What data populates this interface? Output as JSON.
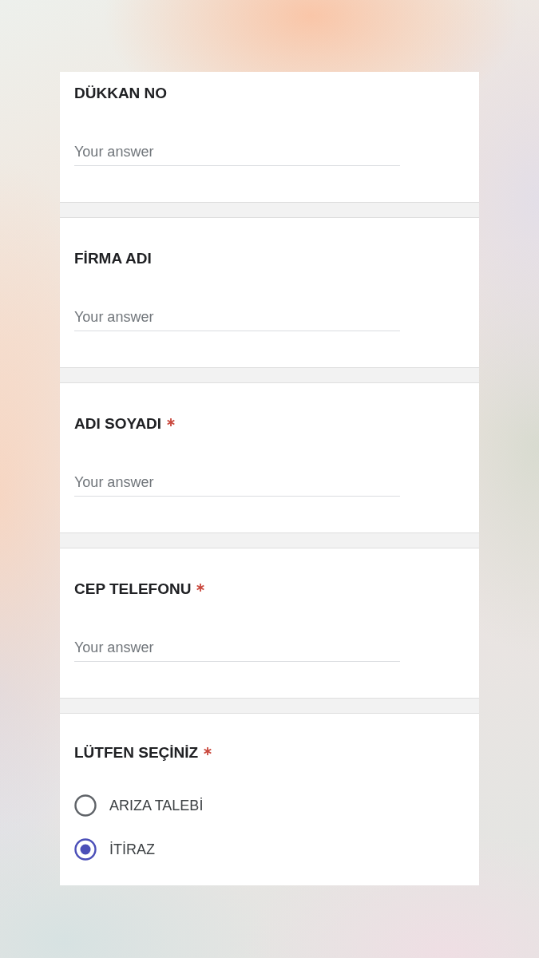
{
  "questions": [
    {
      "kind": "text",
      "title": "DÜKKAN NO",
      "required": false,
      "placeholder": "Your answer"
    },
    {
      "kind": "text",
      "title": "FİRMA ADI",
      "required": false,
      "placeholder": "Your answer"
    },
    {
      "kind": "text",
      "title": "ADI SOYADI",
      "required": true,
      "placeholder": "Your answer"
    },
    {
      "kind": "text",
      "title": "CEP TELEFONU",
      "required": true,
      "placeholder": "Your answer"
    },
    {
      "kind": "choice",
      "title": "LÜTFEN SEÇİNİZ",
      "required": true,
      "options": [
        {
          "label": "ARIZA TALEBİ",
          "selected": false
        },
        {
          "label": "İTİRAZ",
          "selected": true
        }
      ]
    }
  ]
}
